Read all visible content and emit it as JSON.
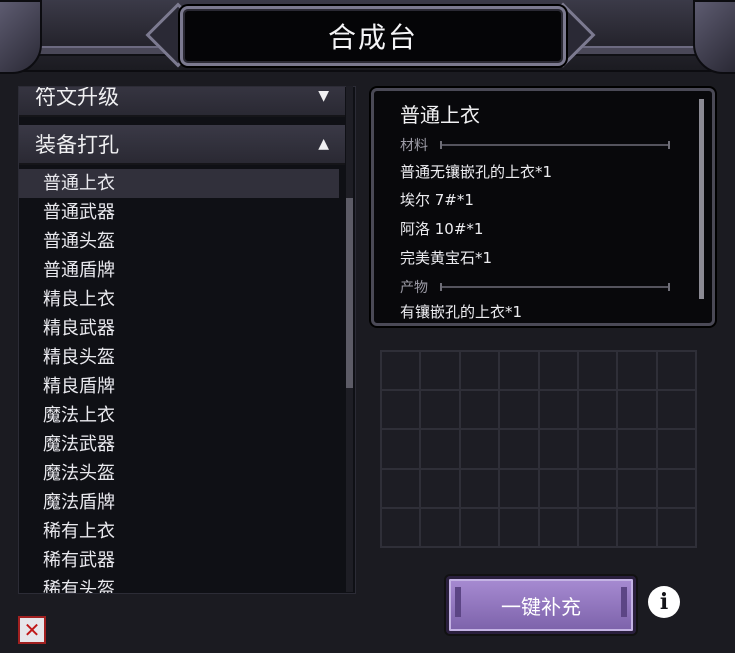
{
  "window": {
    "title": "合成台"
  },
  "categories": [
    {
      "label": "符文升级",
      "arrow": "▼"
    },
    {
      "label": "装备打孔",
      "arrow": "▲"
    }
  ],
  "items": [
    "普通上衣",
    "普通武器",
    "普通头盔",
    "普通盾牌",
    "精良上衣",
    "精良武器",
    "精良头盔",
    "精良盾牌",
    "魔法上衣",
    "魔法武器",
    "魔法头盔",
    "魔法盾牌",
    "稀有上衣",
    "稀有武器",
    "稀有头盔"
  ],
  "selected_item": "普通上衣",
  "detail": {
    "title": "普通上衣",
    "materials_label": "材料",
    "materials": [
      "普通无镶嵌孔的上衣*1",
      "埃尔 7#*1",
      "阿洛 10#*1",
      "完美黄宝石*1"
    ],
    "product_label": "产物",
    "products": [
      "有镶嵌孔的上衣*1"
    ]
  },
  "grid": {
    "columns": 8,
    "rows": 5
  },
  "buttons": {
    "fill": "一键补充",
    "info": "i",
    "close": "✕"
  },
  "colors": {
    "accent": "#a78bd2",
    "background": "#1b1b21",
    "close_red": "#c01818"
  }
}
